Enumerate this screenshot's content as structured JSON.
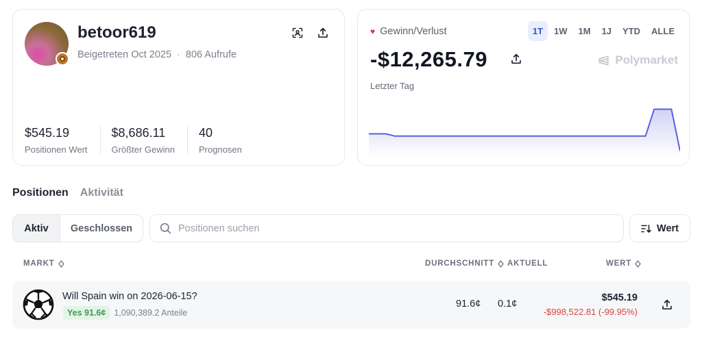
{
  "profile": {
    "username": "betoor619",
    "joined": "Beigetreten Oct 2025",
    "separator": "·",
    "views": "806 Aufrufe",
    "stats": [
      {
        "value": "$545.19",
        "label": "Positionen Wert"
      },
      {
        "value": "$8,686.11",
        "label": "Größter Gewinn"
      },
      {
        "value": "40",
        "label": "Prognosen"
      }
    ]
  },
  "pnl": {
    "label": "Gewinn/Verlust",
    "value": "-$12,265.79",
    "brand": "Polymarket",
    "period": "Letzter Tag",
    "ranges": [
      "1T",
      "1W",
      "1M",
      "1J",
      "YTD",
      "ALLE"
    ],
    "active_range": "1T",
    "line_color": "#5a5fdc"
  },
  "chart_data": {
    "type": "area",
    "title": "",
    "xlabel": "",
    "ylabel": "",
    "series": [
      {
        "values": [
          -11500,
          -11500,
          -11500,
          -11600,
          -11600,
          -11600,
          -11600,
          -11600,
          -11600,
          -11600,
          -11600,
          -11600,
          -11600,
          -11600,
          -11600,
          -11600,
          -11600,
          -11600,
          -11600,
          -11600,
          -11600,
          -11600,
          -11600,
          -11600,
          -11600,
          -11600,
          -11600,
          -11600,
          -11600,
          -11600,
          -11600,
          -11600,
          -11600,
          -10400,
          -10400,
          -10400,
          -12266
        ]
      }
    ],
    "ylim": [
      -12400,
      -10200
    ],
    "grid": false
  },
  "tabs": {
    "positions": "Positionen",
    "activity": "Aktivität"
  },
  "filter": {
    "active": "Aktiv",
    "closed": "Geschlossen"
  },
  "search": {
    "placeholder": "Positionen suchen",
    "value": ""
  },
  "sort": {
    "label": "Wert"
  },
  "table": {
    "headers": {
      "market": "MARKT",
      "avg": "DURCHSCHNITT",
      "current": "AKTUELL",
      "value": "WERT"
    },
    "rows": [
      {
        "title": "Will Spain win on 2026-06-15?",
        "outcome": "Yes 91.6¢",
        "shares": "1,090,389.2 Anteile",
        "avg": "91.6¢",
        "current": "0.1¢",
        "value": "$545.19",
        "change": "-$998,522.81 (-99.95%)",
        "icon": "soccer-ball-icon"
      }
    ]
  }
}
